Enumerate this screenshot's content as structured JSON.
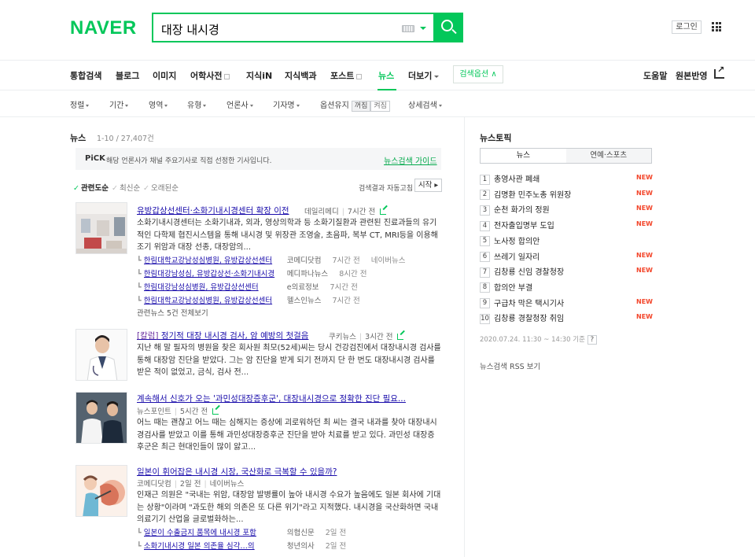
{
  "header": {
    "logo": "NAVER",
    "query": "대장 내시경",
    "login": "로그인"
  },
  "tabs": [
    {
      "label": "통합검색"
    },
    {
      "label": "블로그"
    },
    {
      "label": "이미지"
    },
    {
      "label": "어학사전"
    },
    {
      "label": "지식iN"
    },
    {
      "label": "지식백과"
    },
    {
      "label": "포스트"
    },
    {
      "label": "뉴스"
    },
    {
      "label": "더보기"
    }
  ],
  "search_options": "검색옵션",
  "right_links": {
    "help": "도움말",
    "original": "원본반영"
  },
  "filters": {
    "sort": "정렬",
    "period": "기간",
    "area": "영역",
    "type": "유형",
    "press": "언론사",
    "reporter": "기자명",
    "option_keep": "옵션유지",
    "off": "꺼짐",
    "on": "켜짐",
    "detail": "상세검색"
  },
  "news": {
    "title": "뉴스",
    "count": "1-10 / 27,407건",
    "pick_label": "PiCK",
    "pick_msg": "해당 언론사가 채널 주요기사로 직접 선정한 기사입니다.",
    "guide": "뉴스검색 가이드",
    "sort_relevance": "관련도순",
    "sort_newest": "최신순",
    "sort_oldest": "오래된순",
    "auto_label": "검색결과 자동고침",
    "start": "시작"
  },
  "articles": [
    {
      "title": "유방갑상선센터·소화기내시경센터 확장 이전",
      "source": "데일리메디",
      "time": "7시간 전",
      "desc": "소화기내시경센터는 소화기내과, 외과, 영상의학과 등 소화기질환과 관련된 진료과들의 유기적인 다학제 협진시스템을 통해 내시경 및 위장관 조영술, 초음파, 복부 CT, MRI등을 이용해 조기 위암과 대장 선종, 대장암의...",
      "subs": [
        {
          "title": "한림대학교강남성심병원, 유방갑상선센터",
          "source": "코메디닷컴",
          "time": "7시간 전",
          "extra": "네이버뉴스"
        },
        {
          "title": "한림대강남성심, 유방갑상선·소화기내시경",
          "source": "메디파나뉴스",
          "time": "8시간 전",
          "extra": ""
        },
        {
          "title": "한림대강남성심병원, 유방갑상선센터",
          "source": "e의료정보",
          "time": "7시간 전",
          "extra": ""
        },
        {
          "title": "한림대학교강남성심병원, 유방갑상선센터",
          "source": "헬스인뉴스",
          "time": "7시간 전",
          "extra": ""
        }
      ],
      "more": "관련뉴스 5건 전체보기"
    },
    {
      "prefix": "[칼럼]",
      "title": "정기적 대장 내시경 검사, 암 예방의 첫걸음",
      "source": "쿠키뉴스",
      "time": "3시간 전",
      "desc": "지난 해 말 필자의 병원을 찾은 회사원 최모(52세)씨는 당시 건강검진에서 대장내시경 검사를 통해 대장암 진단을 받았다. 그는 암 진단을 받게 되기 전까지 단 한 번도 대장내시경 검사를 받은 적이 없었고, 금식, 검사 전..."
    },
    {
      "title": "계속해서 신호가 오는 '과민성대장증후군', 대장내시경으로 정확한 진단 필요...",
      "source": "뉴스포인트",
      "time": "5시간 전",
      "desc": "어느 때는 괜찮고 어느 때는 심해지는 증상에 괴로워하던 최 씨는 결국 내과를 찾아 대장내시경검사를 받았고 이를 통해 과민성대장증후군 진단을 받아 치료를 받고 있다. 과민성 대장증후군은 최근 현대인들이 많이 앓고..."
    },
    {
      "title": "일본이 휘어잡은 내시경 시장, 국산화로 극복할 수 있을까?",
      "source": "코메디닷컴",
      "time": "2일 전",
      "extra": "네이버뉴스",
      "desc": "인재근 의원은 \"국내는 위암, 대장암 발병률이 높아 내시경 수요가 높음에도 일본 회사에 기대는 상황\"이라며 \"과도한 해외 의존은 또 다른 위기\"라고 지적했다. 내시경을 국산화하면 국내 의료기기 산업을 글로벌화하는...",
      "subs": [
        {
          "title": "일본이 수출금지 품목에 내시경 포함",
          "source": "의협신문",
          "time": "2일 전"
        },
        {
          "title": "소화기내시경 일본 의존율 심각…의",
          "source": "청년의사",
          "time": "2일 전"
        }
      ]
    }
  ],
  "topics": {
    "title": "뉴스토픽",
    "tab_news": "뉴스",
    "tab_ent": "연예·스포츠",
    "items": [
      {
        "rank": "1",
        "text": "총영사관 폐쇄",
        "new": "NEW"
      },
      {
        "rank": "2",
        "text": "김명환 민주노총 위원장",
        "new": "NEW"
      },
      {
        "rank": "3",
        "text": "순천 화가의 정원",
        "new": "NEW"
      },
      {
        "rank": "4",
        "text": "전자출입명부 도입",
        "new": "NEW"
      },
      {
        "rank": "5",
        "text": "노사정 합의안",
        "new": ""
      },
      {
        "rank": "6",
        "text": "쓰레기 일자리",
        "new": "NEW"
      },
      {
        "rank": "7",
        "text": "김창룡 신임 경찰청장",
        "new": "NEW"
      },
      {
        "rank": "8",
        "text": "합의안 부결",
        "new": ""
      },
      {
        "rank": "9",
        "text": "구급차 막은 택시기사",
        "new": "NEW"
      },
      {
        "rank": "10",
        "text": "김창룡 경찰청장 취임",
        "new": "NEW"
      }
    ],
    "time": "2020.07.24. 11:30 ~ 14:30 기준",
    "help": "?",
    "rss": "뉴스검색 RSS 보기"
  }
}
